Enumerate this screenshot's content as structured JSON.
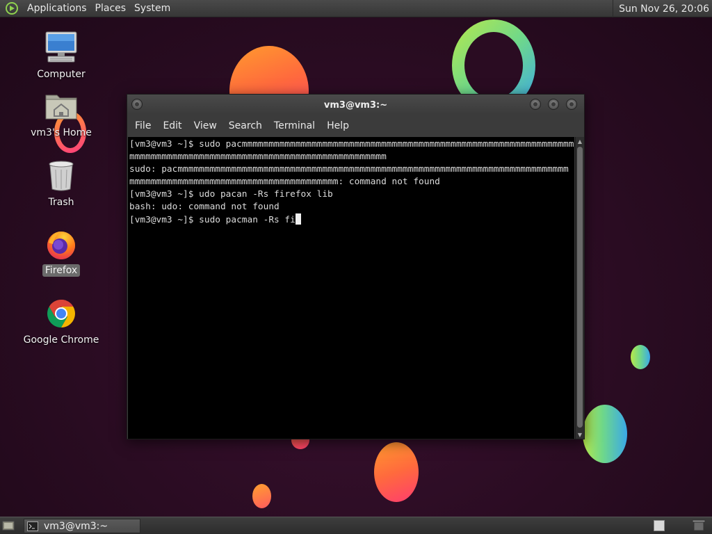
{
  "top_panel": {
    "menus": [
      "Applications",
      "Places",
      "System"
    ],
    "clock": "Sun Nov 26, 20:06"
  },
  "desktop": {
    "icons": [
      {
        "label": "Computer",
        "icon": "computer-icon"
      },
      {
        "label": "vm3's Home",
        "icon": "home-folder-icon"
      },
      {
        "label": "Trash",
        "icon": "trash-icon"
      },
      {
        "label": "Firefox",
        "icon": "firefox-icon",
        "selected": true
      },
      {
        "label": "Google Chrome",
        "icon": "chrome-icon"
      }
    ]
  },
  "terminal": {
    "title": "vm3@vm3:~",
    "menu": [
      "File",
      "Edit",
      "View",
      "Search",
      "Terminal",
      "Help"
    ],
    "lines": [
      "[vm3@vm3 ~]$ sudo pacmmmmmmmmmmmmmmmmmmmmmmmmmmmmmmmmmmmmmmmmmmmmmmmmmmmmmmmmmmmmmmmmmmmm",
      "mmmmmmmmmmmmmmmmmmmmmmmmmmmmmmmmmmmmmmmmmmmmmmmm",
      "sudo: pacmmmmmmmmmmmmmmmmmmmmmmmmmmmmmmmmmmmmmmmmmmmmmmmmmmmmmmmmmmmmmmmmmmmmmmmmm",
      "mmmmmmmmmmmmmmmmmmmmmmmmmmmmmmmmmmmmmmm: command not found",
      "[vm3@vm3 ~]$ udo pacan -Rs firefox lib",
      "bash: udo: command not found"
    ],
    "prompt_line": "[vm3@vm3 ~]$ sudo pacman -Rs fi"
  },
  "bottom_panel": {
    "tasks": [
      {
        "label": "vm3@vm3:~",
        "icon": "terminal-icon"
      }
    ]
  },
  "colors": {
    "panel": "#3a3a3a",
    "terminal_bg": "#000000",
    "terminal_fg": "#dcdcdc",
    "desktop_bg": "#2a0c22"
  }
}
